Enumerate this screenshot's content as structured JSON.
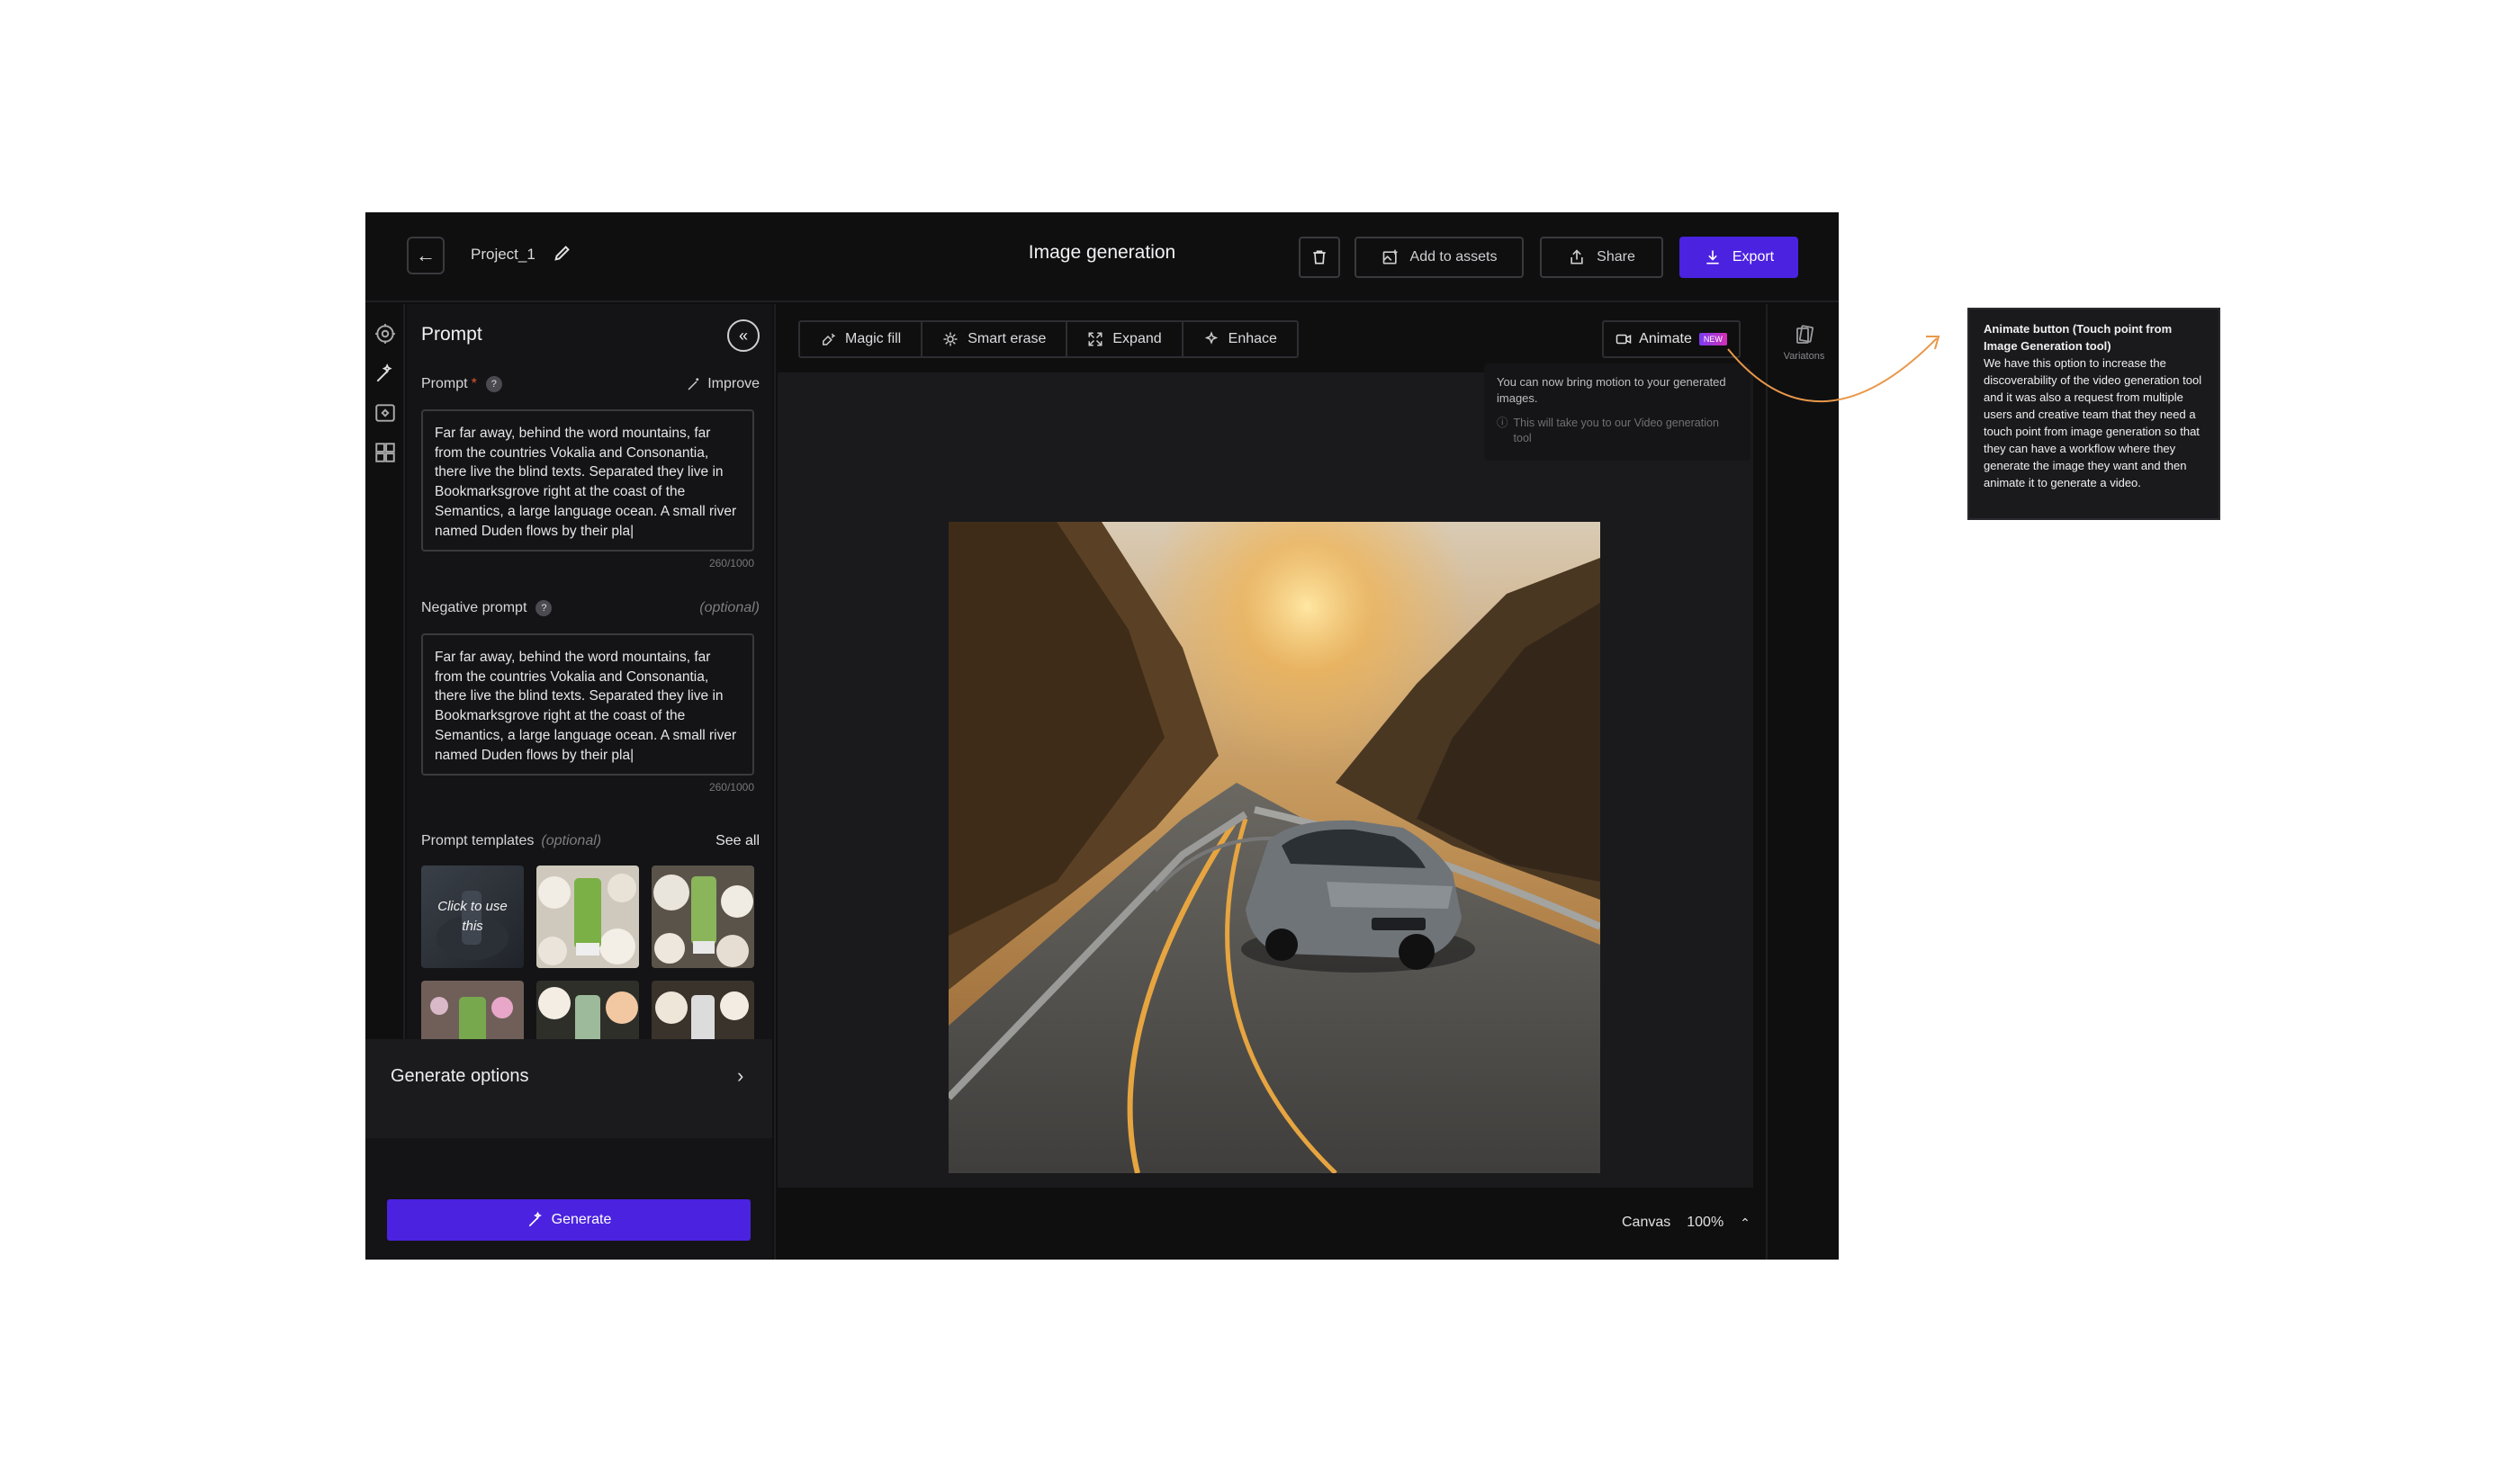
{
  "header": {
    "project_name": "Project_1",
    "title": "Image generation",
    "add_to_assets": "Add to assets",
    "share": "Share",
    "export": "Export"
  },
  "panel": {
    "title": "Prompt",
    "prompt_label": "Prompt",
    "required_mark": "*",
    "help": "?",
    "improve": "Improve",
    "prompt_text": "Far far away, behind the word mountains, far from the countries Vokalia and Consonantia, there live the blind texts. Separated they live in Bookmarksgrove right at the coast of the Semantics, a large language ocean. A small river named Duden flows by their pla|",
    "prompt_counter": "260/1000",
    "negative_label": "Negative prompt",
    "optional": "(optional)",
    "negative_text": "Far far away, behind the word mountains, far from the countries Vokalia and Consonantia, there live the blind texts. Separated they live in Bookmarksgrove right at the coast of the Semantics, a large language ocean. A small river named Duden flows by their pla|",
    "negative_counter": "260/1000",
    "templates_label": "Prompt templates",
    "templates_optional": "(optional)",
    "see_all": "See all",
    "template_hover_text": "Click to use this",
    "generate_options": "Generate options",
    "generate": "Generate"
  },
  "toolbar": {
    "magic_fill": "Magic fill",
    "smart_erase": "Smart erase",
    "expand": "Expand",
    "enhance": "Enhace",
    "animate": "Animate",
    "new_badge": "NEW"
  },
  "tooltip": {
    "main": "You can now bring motion to your generated images.",
    "sub": "This will take you to our Video generation tool"
  },
  "canvas": {
    "label": "Canvas",
    "zoom": "100%"
  },
  "right_rail": {
    "variations": "Variatons"
  },
  "annotation": {
    "title": "Animate button (Touch point from Image Generation tool)",
    "body": "We have this option to increase the discoverability of the video generation tool and it was also a request from multiple users and creative team that they need a touch point from image generation so that they can have a workflow where they generate the image they want and then animate it to generate a video."
  },
  "colors": {
    "accent": "#4b22e0",
    "background": "#0f0f10",
    "panel": "#141416",
    "annotation_arrow": "#e9984a"
  },
  "icons": [
    "back-arrow-icon",
    "pencil-icon",
    "trash-icon",
    "add-image-icon",
    "share-icon",
    "download-icon",
    "settings-icon",
    "magic-wand-icon",
    "image-frame-icon",
    "grid-icon",
    "double-chevron-left-icon",
    "help-icon",
    "wand-icon",
    "magic-fill-icon",
    "smart-erase-icon",
    "expand-icon",
    "enhance-icon",
    "video-icon",
    "info-icon",
    "chevron-up-icon",
    "chevron-right-icon",
    "variations-icon"
  ]
}
